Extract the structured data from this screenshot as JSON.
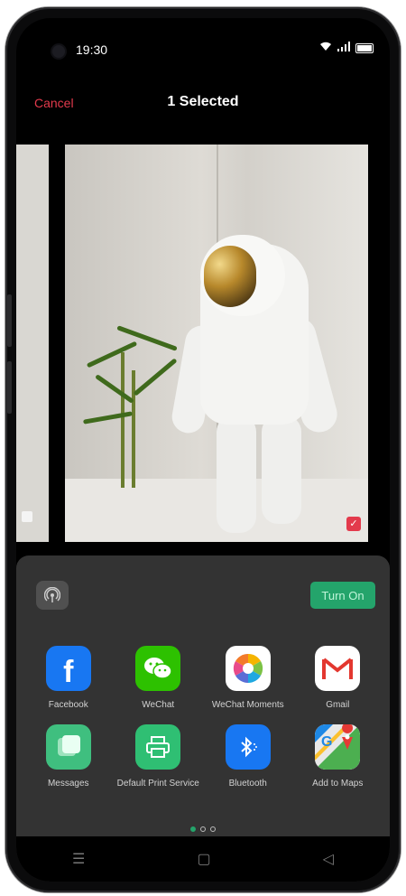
{
  "status_bar": {
    "time": "19:30"
  },
  "top_bar": {
    "cancel_label": "Cancel",
    "title": "1 Selected"
  },
  "share_sheet": {
    "turn_on_label": "Turn On",
    "row1": [
      {
        "label": "Facebook",
        "icon": "facebook-icon"
      },
      {
        "label": "WeChat",
        "icon": "wechat-icon"
      },
      {
        "label": "WeChat Moments",
        "icon": "wechat-moments-icon"
      },
      {
        "label": "Gmail",
        "icon": "gmail-icon"
      }
    ],
    "row2": [
      {
        "label": "Messages",
        "icon": "messages-icon"
      },
      {
        "label": "Default Print Service",
        "icon": "print-icon"
      },
      {
        "label": "Bluetooth",
        "icon": "bluetooth-icon"
      },
      {
        "label": "Add to Maps",
        "icon": "maps-icon"
      }
    ],
    "page_dots": 3,
    "active_page": 1
  },
  "colors": {
    "accent_red": "#e33a4c",
    "accent_green": "#24a46b",
    "sheet_bg": "#333333"
  }
}
